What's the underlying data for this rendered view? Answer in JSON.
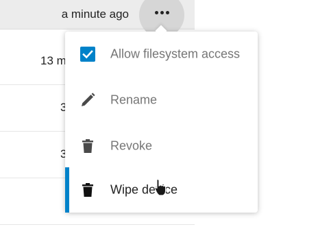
{
  "sessions": {
    "rows": [
      {
        "time": "a minute ago"
      },
      {
        "time": "13 m"
      },
      {
        "time": "3"
      },
      {
        "time": "3"
      },
      {
        "time": ""
      }
    ],
    "more_icon": "three-dots-icon"
  },
  "menu": {
    "items": [
      {
        "label": "Allow filesystem access",
        "icon": "checkbox-checked-icon",
        "checked": true
      },
      {
        "label": "Rename",
        "icon": "pencil-icon"
      },
      {
        "label": "Revoke",
        "icon": "trash-icon"
      },
      {
        "label": "Wipe device",
        "icon": "trash-icon",
        "active": true
      }
    ]
  },
  "colors": {
    "accent": "#0082c9",
    "menu_text": "#767676",
    "active_text": "#222222"
  }
}
